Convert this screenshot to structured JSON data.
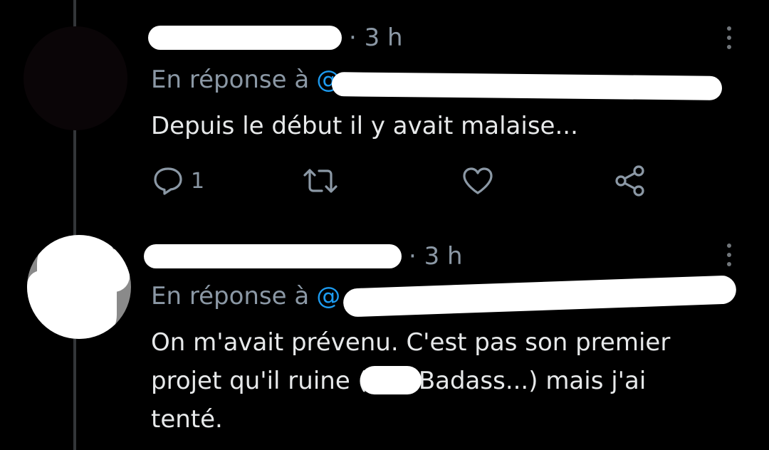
{
  "tweets": [
    {
      "time": "· 3 h",
      "reply_prefix": "En réponse à",
      "reply_handle": "@",
      "text": "Depuis le début il y avait malaise...",
      "actions": {
        "reply_count": "1",
        "retweet_count": "",
        "like_count": ""
      }
    },
    {
      "time": "· 3 h",
      "reply_prefix": "En réponse à",
      "reply_handle": "@",
      "text_line1": "On m'avait prévenu. C'est pas son premier",
      "text_line2_a": "projet qu'il ruine (",
      "text_line2_b": "Badass...) mais j'ai",
      "text_line3": "tenté."
    }
  ],
  "icons": {
    "reply": "reply-icon",
    "retweet": "retweet-icon",
    "like": "heart-icon",
    "share": "share-icon",
    "more": "more-vertical-icon"
  },
  "colors": {
    "background": "#000000",
    "text": "#e7e9ea",
    "muted": "#8b98a5",
    "link": "#1d9bf0",
    "thread": "#333639"
  }
}
